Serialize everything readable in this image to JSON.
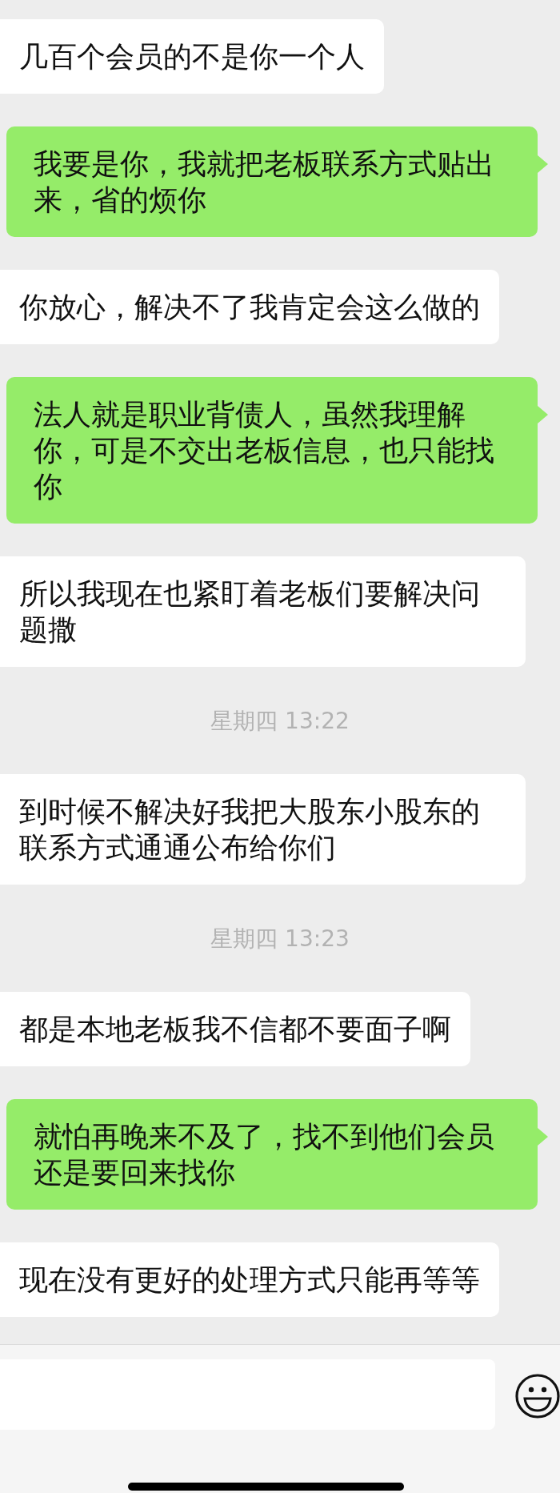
{
  "messages": [
    {
      "kind": "received",
      "text": "几百个会员的不是你一个人"
    },
    {
      "kind": "sent",
      "text": "我要是你，我就把老板联系方式贴出来，省的烦你"
    },
    {
      "kind": "received",
      "text": "你放心，解决不了我肯定会这么做的"
    },
    {
      "kind": "sent",
      "text": "法人就是职业背债人，虽然我理解你，可是不交出老板信息，也只能找你"
    },
    {
      "kind": "received",
      "text": "所以我现在也紧盯着老板们要解决问题撒"
    },
    {
      "kind": "timestamp",
      "text": "星期四 13:22"
    },
    {
      "kind": "received",
      "text": "到时候不解决好我把大股东小股东的联系方式通通公布给你们"
    },
    {
      "kind": "timestamp",
      "text": "星期四 13:23"
    },
    {
      "kind": "received",
      "text": "都是本地老板我不信都不要面子啊"
    },
    {
      "kind": "sent",
      "text": "就怕再晚来不及了，找不到他们会员还是要回来找你"
    },
    {
      "kind": "received",
      "text": "现在没有更好的处理方式只能再等等"
    }
  ]
}
